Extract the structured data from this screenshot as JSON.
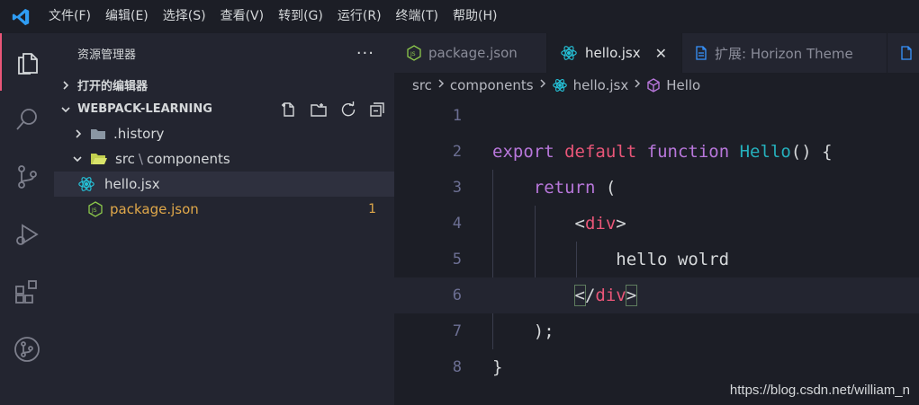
{
  "menu": [
    "文件(F)",
    "编辑(E)",
    "选择(S)",
    "查看(V)",
    "转到(G)",
    "运行(R)",
    "终端(T)",
    "帮助(H)"
  ],
  "sidebar": {
    "title": "资源管理器",
    "more": "···",
    "open_editors": "打开的编辑器",
    "project": "WEBPACK-LEARNING",
    "tree": {
      "history": ".history",
      "src_folder": "src",
      "src_sep": "\\",
      "components": "components",
      "hello": "hello.jsx",
      "package": "package.json",
      "package_badge": "1"
    }
  },
  "tabs": [
    {
      "label": "package.json",
      "icon": "nodejs-icon"
    },
    {
      "label": "hello.jsx",
      "icon": "react-icon",
      "active": true
    },
    {
      "label": "扩展: Horizon Theme",
      "icon": "file-icon"
    }
  ],
  "breadcrumb": {
    "src": "src",
    "components": "components",
    "file": "hello.jsx",
    "symbol": "Hello"
  },
  "code": {
    "line_numbers": [
      "1",
      "2",
      "3",
      "4",
      "5",
      "6",
      "7",
      "8"
    ],
    "export": "export",
    "default": "default",
    "function": "function",
    "name": "Hello",
    "sig_rest": "() {",
    "return": "return",
    "paren_open": "(",
    "lt": "<",
    "gt": ">",
    "div": "div",
    "slash": "/",
    "text": "hello wolrd",
    "close_paren": ");",
    "close_brace": "}"
  },
  "watermark": "https://blog.csdn.net/william_n",
  "colors": {
    "accent": "#e95678",
    "purple": "#b877db",
    "cyan": "#25b0bc",
    "modified": "#e0a84a"
  }
}
